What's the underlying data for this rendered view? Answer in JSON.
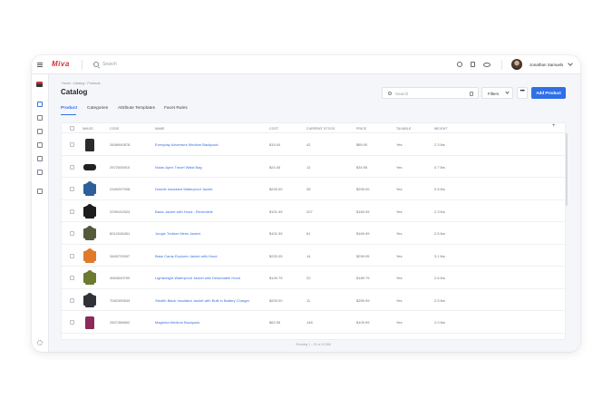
{
  "app": {
    "logo": "Miva",
    "search_placeholder": "Search",
    "user": "Jonathan Samuels"
  },
  "page": {
    "breadcrumb": "Home  ›  Catalog  ›  Products",
    "title": "Catalog",
    "search_placeholder": "Search",
    "filters_label": "Filters",
    "more_label": "•••",
    "add_label": "Add Product"
  },
  "tabs": [
    "Product",
    "Categories",
    "Attribute Templates",
    "Facet Rules"
  ],
  "columns": {
    "image": "IMAGE",
    "code": "CODE",
    "name": "NAME",
    "cost": "COST",
    "stock": "CURRENT STOCK",
    "price": "PRICE",
    "taxable": "TAXABLE",
    "weight": "WEIGHT"
  },
  "add_column": "+",
  "rows": [
    {
      "code": "3458940678",
      "name": "Everyday Adventure Medium Backpack",
      "cost": "$19.00",
      "stock": "42",
      "price": "$89.00",
      "taxable": "Yes",
      "weight": "2.3 lbs",
      "img": "backpack",
      "color": "#2b2b2b"
    },
    {
      "code": "2572535910",
      "name": "Nolan Apex Travel Waist Bag",
      "cost": "$24.45",
      "stock": "12",
      "price": "$34.95",
      "taxable": "Yes",
      "weight": "0.7 lbs",
      "img": "bag",
      "color": "#222222"
    },
    {
      "code": "2345207008",
      "name": "Double Insulated Waterproof Jacket",
      "cost": "$225.00",
      "stock": "35",
      "price": "$295.00",
      "taxable": "Yes",
      "weight": "2.6 lbs",
      "img": "jacket",
      "color": "#2f5f9a"
    },
    {
      "code": "2299102524",
      "name": "Basic Jacket with Hood - Reversible",
      "cost": "$101.99",
      "stock": "207",
      "price": "$160.99",
      "taxable": "Yes",
      "weight": "2.3 lbs",
      "img": "jacket",
      "color": "#1d1d1d"
    },
    {
      "code": "8012045451",
      "name": "Jungle Trekker Mens Jacket",
      "cost": "$101.99",
      "stock": "61",
      "price": "$169.99",
      "taxable": "Yes",
      "weight": "2.5 lbs",
      "img": "jacket",
      "color": "#555a3a"
    },
    {
      "code": "3465729057",
      "name": "Base Camp Explorer Jacket with Hood",
      "cost": "$220.05",
      "stock": "14",
      "price": "$299.95",
      "taxable": "Yes",
      "weight": "3.1 lbs",
      "img": "jacket",
      "color": "#e07a2a"
    },
    {
      "code": "4563649790",
      "name": "Lightweight Waterproof Jacket with Detachable Hood",
      "cost": "$149.79",
      "stock": "22",
      "price": "$189.79",
      "taxable": "Yes",
      "weight": "2.6 lbs",
      "img": "jacket",
      "color": "#6b7a2e"
    },
    {
      "code": "7082399633",
      "name": "Stealth Black Insulated Jacket with Built in Battery Charger",
      "cost": "$209.00",
      "stock": "11",
      "price": "$259.99",
      "taxable": "Yes",
      "weight": "2.5 lbs",
      "img": "jacket",
      "color": "#303238"
    },
    {
      "code": "2507356692",
      "name": "Magenta Medium Backpack",
      "cost": "$62.95",
      "stock": "148",
      "price": "$109.99",
      "taxable": "Yes",
      "weight": "2.0 lbs",
      "img": "backpack",
      "color": "#8c2a5a"
    }
  ],
  "footer": "Showing 1 – 20 of 12,556",
  "colors": {
    "accent": "#2f6fe8",
    "brand": "#d6303a",
    "link": "#3b6fe0"
  },
  "icons": [
    "menu-icon",
    "search-icon",
    "history-icon",
    "bookmark-icon",
    "eye-icon",
    "chevron-down-icon",
    "settings-icon"
  ]
}
